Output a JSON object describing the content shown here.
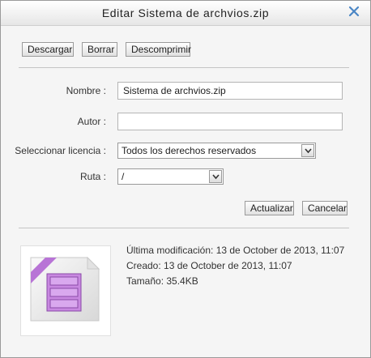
{
  "dialog": {
    "title": "Editar Sistema de archvios.zip"
  },
  "toolbar": {
    "download_label": "Descargar",
    "delete_label": "Borrar",
    "unzip_label": "Descomprimir"
  },
  "form": {
    "name_label": "Nombre :",
    "name_value": "Sistema de archvios.zip",
    "author_label": "Autor :",
    "author_value": "",
    "license_label": "Seleccionar licencia :",
    "license_value": "Todos los derechos reservados",
    "path_label": "Ruta :",
    "path_value": "/"
  },
  "actions": {
    "update_label": "Actualizar",
    "cancel_label": "Cancelar"
  },
  "details": {
    "modified": "Última modificación: 13 de October de 2013, 11:07",
    "created": "Creado: 13 de October de 2013, 11:07",
    "size": "Tamaño: 35.4KB"
  },
  "icons": {
    "close": "close-icon",
    "dropdown": "chevron-down-icon",
    "file": "zip-file-icon"
  },
  "colors": {
    "close_icon": "#4a86c5",
    "zip_ribbon": "#b874d6",
    "zip_body": "#c888e0"
  }
}
